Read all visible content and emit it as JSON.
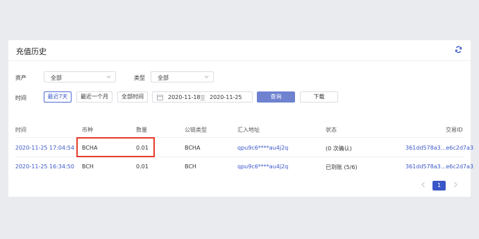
{
  "header": {
    "title": "充值历史"
  },
  "filters": {
    "asset_label": "资产",
    "asset_value": "全部",
    "type_label": "类型",
    "type_value": "全部",
    "time_label": "时间",
    "time_buttons": [
      "最近7天",
      "最近一个月",
      "全部时间"
    ],
    "active_time_button": 0,
    "date_start": "2020-11-18",
    "date_sep": "至",
    "date_end": "2020-11-25",
    "query_label": "查询",
    "download_label": "下载"
  },
  "table": {
    "headers": [
      "时间",
      "币种",
      "数量",
      "公链类型",
      "汇入地址",
      "状态",
      "交易ID"
    ],
    "rows": [
      [
        "2020-11-25 17:04:54",
        "BCHA",
        "0.01",
        "BCHA",
        "qpu9c6****au4j2q",
        "(0 次确认)",
        "361dd578a3...e6c2d7a3"
      ],
      [
        "2020-11-25 16:34:50",
        "BCH",
        "0.01",
        "BCH",
        "qpu9c6****au4j2q",
        "已到账 (5/6)",
        "361dd578a3...e6c2d7a3"
      ]
    ]
  },
  "pagination": {
    "current": "1"
  },
  "colors": {
    "accent": "#3a57c8",
    "highlight": "#e53a2a"
  }
}
